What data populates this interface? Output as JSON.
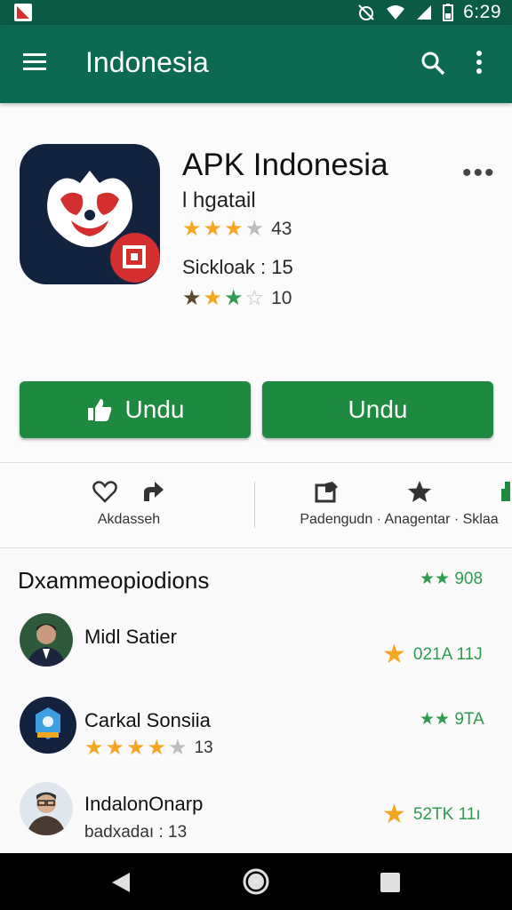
{
  "status_bar": {
    "time": "6:29"
  },
  "app_bar": {
    "title": "Indonesia"
  },
  "app": {
    "name": "APK Indonesia",
    "developer": "l hgatail",
    "rating_value": "43",
    "size_label": "Sickloak : 15",
    "rating2_value": "10"
  },
  "buttons": {
    "primary": "Undu",
    "secondary": "Undu"
  },
  "actions": {
    "left_label": "Akdasseh",
    "right_labels": "Padengudn · Anagentar · Sklaa"
  },
  "reviews_section": {
    "title": "Dxammeopiodions",
    "score": "★★ 908",
    "items": [
      {
        "name": "Midl Satier",
        "sub": "",
        "right": "021A 11J"
      },
      {
        "name": "Carkal Sonsiia",
        "sub": "13",
        "right": "★★ 9TA"
      },
      {
        "name": "IndalonOnarp",
        "sub": "badxadaı : 13",
        "right": "52TK 11ı"
      }
    ]
  },
  "colors": {
    "app_bar": "#0d6a52",
    "button": "#1e8a3f",
    "star": "#f5a623",
    "green": "#2e9b4f"
  }
}
